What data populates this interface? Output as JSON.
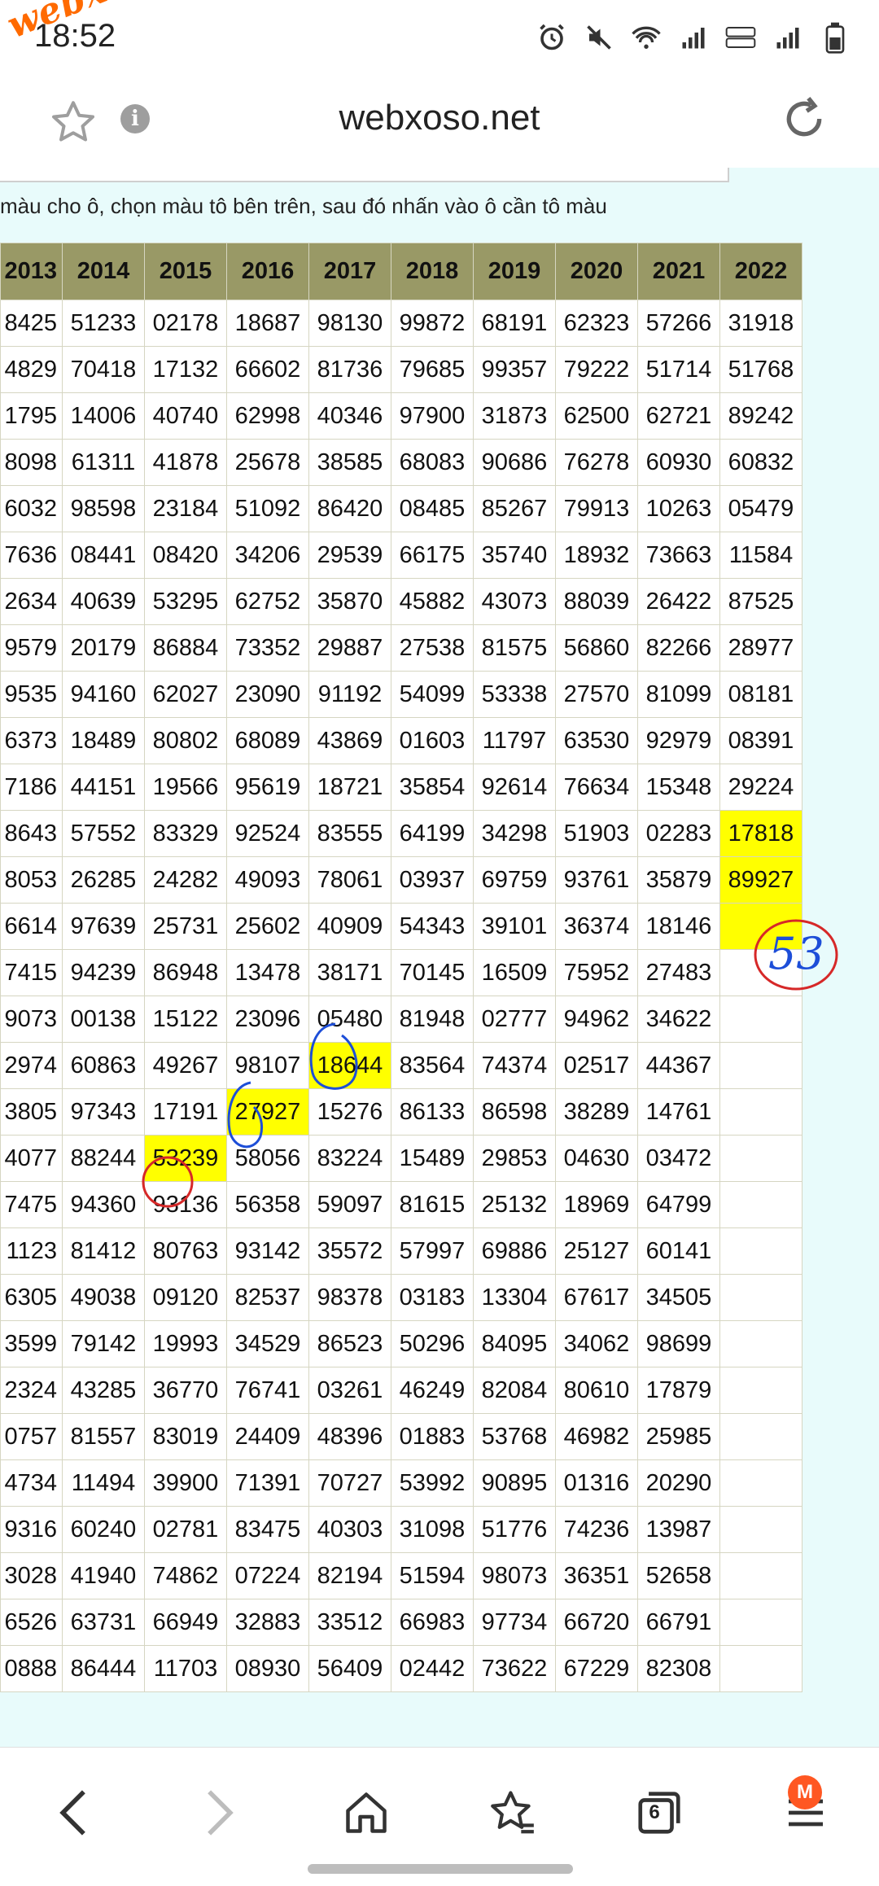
{
  "status_bar": {
    "time": "18:52",
    "watermark": "webxoso.net"
  },
  "browser": {
    "site_title": "webxoso.net",
    "tab_count": "6",
    "menu_badge": "M"
  },
  "instruction": "màu cho ô, chọn màu tô bên trên, sau đó nhấn vào ô cần tô màu",
  "table": {
    "headers": [
      "2013",
      "2014",
      "2015",
      "2016",
      "2017",
      "2018",
      "2019",
      "2020",
      "2021",
      "2022"
    ],
    "rows": [
      [
        "8425",
        "51233",
        "02178",
        "18687",
        "98130",
        "99872",
        "68191",
        "62323",
        "57266",
        "31918"
      ],
      [
        "4829",
        "70418",
        "17132",
        "66602",
        "81736",
        "79685",
        "99357",
        "79222",
        "51714",
        "51768"
      ],
      [
        "1795",
        "14006",
        "40740",
        "62998",
        "40346",
        "97900",
        "31873",
        "62500",
        "62721",
        "89242"
      ],
      [
        "8098",
        "61311",
        "41878",
        "25678",
        "38585",
        "68083",
        "90686",
        "76278",
        "60930",
        "60832"
      ],
      [
        "6032",
        "98598",
        "23184",
        "51092",
        "86420",
        "08485",
        "85267",
        "79913",
        "10263",
        "05479"
      ],
      [
        "7636",
        "08441",
        "08420",
        "34206",
        "29539",
        "66175",
        "35740",
        "18932",
        "73663",
        "11584"
      ],
      [
        "2634",
        "40639",
        "53295",
        "62752",
        "35870",
        "45882",
        "43073",
        "88039",
        "26422",
        "87525"
      ],
      [
        "9579",
        "20179",
        "86884",
        "73352",
        "29887",
        "27538",
        "81575",
        "56860",
        "82266",
        "28977"
      ],
      [
        "9535",
        "94160",
        "62027",
        "23090",
        "91192",
        "54099",
        "53338",
        "27570",
        "81099",
        "08181"
      ],
      [
        "6373",
        "18489",
        "80802",
        "68089",
        "43869",
        "01603",
        "11797",
        "63530",
        "92979",
        "08391"
      ],
      [
        "7186",
        "44151",
        "19566",
        "95619",
        "18721",
        "35854",
        "92614",
        "76634",
        "15348",
        "29224"
      ],
      [
        "8643",
        "57552",
        "83329",
        "92524",
        "83555",
        "64199",
        "34298",
        "51903",
        "02283",
        "17818"
      ],
      [
        "8053",
        "26285",
        "24282",
        "49093",
        "78061",
        "03937",
        "69759",
        "93761",
        "35879",
        "89927"
      ],
      [
        "6614",
        "97639",
        "25731",
        "25602",
        "40909",
        "54343",
        "39101",
        "36374",
        "18146",
        ""
      ],
      [
        "7415",
        "94239",
        "86948",
        "13478",
        "38171",
        "70145",
        "16509",
        "75952",
        "27483",
        ""
      ],
      [
        "9073",
        "00138",
        "15122",
        "23096",
        "05480",
        "81948",
        "02777",
        "94962",
        "34622",
        ""
      ],
      [
        "2974",
        "60863",
        "49267",
        "98107",
        "18644",
        "83564",
        "74374",
        "02517",
        "44367",
        ""
      ],
      [
        "3805",
        "97343",
        "17191",
        "27927",
        "15276",
        "86133",
        "86598",
        "38289",
        "14761",
        ""
      ],
      [
        "4077",
        "88244",
        "53239",
        "58056",
        "83224",
        "15489",
        "29853",
        "04630",
        "03472",
        ""
      ],
      [
        "7475",
        "94360",
        "93136",
        "56358",
        "59097",
        "81615",
        "25132",
        "18969",
        "64799",
        ""
      ],
      [
        "1123",
        "81412",
        "80763",
        "93142",
        "35572",
        "57997",
        "69886",
        "25127",
        "60141",
        ""
      ],
      [
        "6305",
        "49038",
        "09120",
        "82537",
        "98378",
        "03183",
        "13304",
        "67617",
        "34505",
        ""
      ],
      [
        "3599",
        "79142",
        "19993",
        "34529",
        "86523",
        "50296",
        "84095",
        "34062",
        "98699",
        ""
      ],
      [
        "2324",
        "43285",
        "36770",
        "76741",
        "03261",
        "46249",
        "82084",
        "80610",
        "17879",
        ""
      ],
      [
        "0757",
        "81557",
        "83019",
        "24409",
        "48396",
        "01883",
        "53768",
        "46982",
        "25985",
        ""
      ],
      [
        "4734",
        "11494",
        "39900",
        "71391",
        "70727",
        "53992",
        "90895",
        "01316",
        "20290",
        ""
      ],
      [
        "9316",
        "60240",
        "02781",
        "83475",
        "40303",
        "31098",
        "51776",
        "74236",
        "13987",
        ""
      ],
      [
        "3028",
        "41940",
        "74862",
        "07224",
        "82194",
        "51594",
        "98073",
        "36351",
        "52658",
        ""
      ],
      [
        "6526",
        "63731",
        "66949",
        "32883",
        "33512",
        "66983",
        "97734",
        "66720",
        "66791",
        ""
      ],
      [
        "0888",
        "86444",
        "11703",
        "08930",
        "56409",
        "02442",
        "73622",
        "67229",
        "82308",
        ""
      ]
    ],
    "highlights": [
      [
        11,
        9
      ],
      [
        12,
        9
      ],
      [
        13,
        9
      ],
      [
        16,
        4
      ],
      [
        17,
        3
      ],
      [
        18,
        2
      ]
    ]
  },
  "handwriting": {
    "note": "53"
  }
}
